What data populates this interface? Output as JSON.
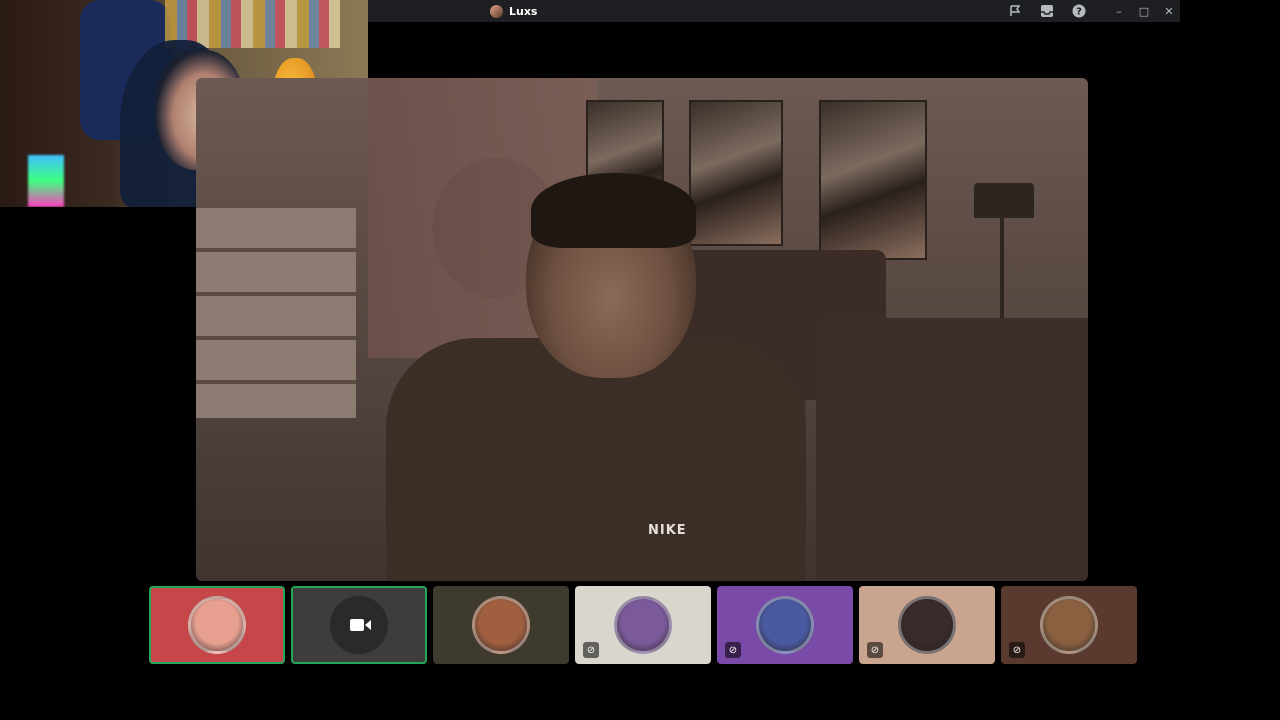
{
  "window": {
    "title": "Luxs",
    "controls": {
      "minimize": "–",
      "maximize": "□",
      "close": "✕"
    },
    "toolbar_icons": [
      "flag-icon",
      "inbox-icon",
      "help-icon"
    ]
  },
  "main_stream": {
    "shirt_logo": "NIKE"
  },
  "participants": [
    {
      "name_icon": "avatar",
      "bg": "#c6474a",
      "avatar_color": "#e8a090",
      "speaking": true,
      "muted": false,
      "camera": false
    },
    {
      "name_icon": "camera-off",
      "bg": "#3d3d3d",
      "avatar_color": "#2a2a2a",
      "speaking": true,
      "muted": false,
      "camera": true
    },
    {
      "name_icon": "avatar",
      "bg": "#3e3a2e",
      "avatar_color": "#a06040",
      "speaking": false,
      "muted": false,
      "camera": false
    },
    {
      "name_icon": "avatar",
      "bg": "#d9d6cd",
      "avatar_color": "#7a5a9a",
      "speaking": false,
      "muted": true,
      "camera": false
    },
    {
      "name_icon": "avatar",
      "bg": "#7a4aa8",
      "avatar_color": "#4a5aa0",
      "speaking": false,
      "muted": true,
      "camera": false
    },
    {
      "name_icon": "avatar",
      "bg": "#c9a48e",
      "avatar_color": "#3a2a2a",
      "speaking": false,
      "muted": true,
      "camera": false
    },
    {
      "name_icon": "avatar",
      "bg": "#5a3a2e",
      "avatar_color": "#8a6040",
      "speaking": false,
      "muted": true,
      "camera": false
    }
  ],
  "mute_glyph": "⊘"
}
